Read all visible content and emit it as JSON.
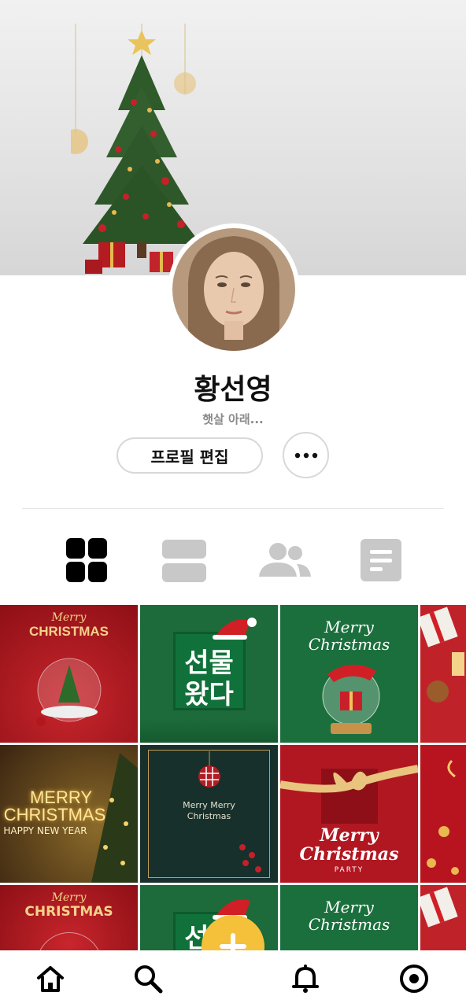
{
  "profile": {
    "name": "황선영",
    "bio": "햇살 아래..."
  },
  "actions": {
    "edit_label": "프로필 편집",
    "more_icon": "more-icon"
  },
  "tabs": [
    {
      "name": "grid",
      "icon": "grid-icon",
      "active": true
    },
    {
      "name": "list",
      "icon": "list-icon",
      "active": false
    },
    {
      "name": "friends",
      "icon": "people-icon",
      "active": false
    },
    {
      "name": "posts",
      "icon": "document-icon",
      "active": false
    }
  ],
  "posts": {
    "tile1": {
      "line1": "Merry",
      "line2": "CHRISTMAS"
    },
    "tile2": {
      "line1": "선물",
      "line2": "왔다"
    },
    "tile3": {
      "line1": "Merry",
      "line2": "Christmas"
    },
    "tile5": {
      "line1": "MERRY",
      "line2": "CHRISTMAS",
      "line3": "HAPPY NEW YEAR"
    },
    "tile6": {
      "line1": "Merry Merry",
      "line2": "Christmas"
    },
    "tile7": {
      "line1": "Merry",
      "line2": "Christmas",
      "line3": "PARTY"
    }
  },
  "colors": {
    "accent": "#f5c13b",
    "active_tab": "#000000",
    "inactive_tab": "#c8c8c8"
  },
  "nav": [
    {
      "name": "home",
      "icon": "home-icon"
    },
    {
      "name": "search",
      "icon": "search-icon"
    },
    {
      "name": "add",
      "icon": "plus-icon"
    },
    {
      "name": "notifications",
      "icon": "bell-icon"
    },
    {
      "name": "profile",
      "icon": "target-icon"
    }
  ]
}
